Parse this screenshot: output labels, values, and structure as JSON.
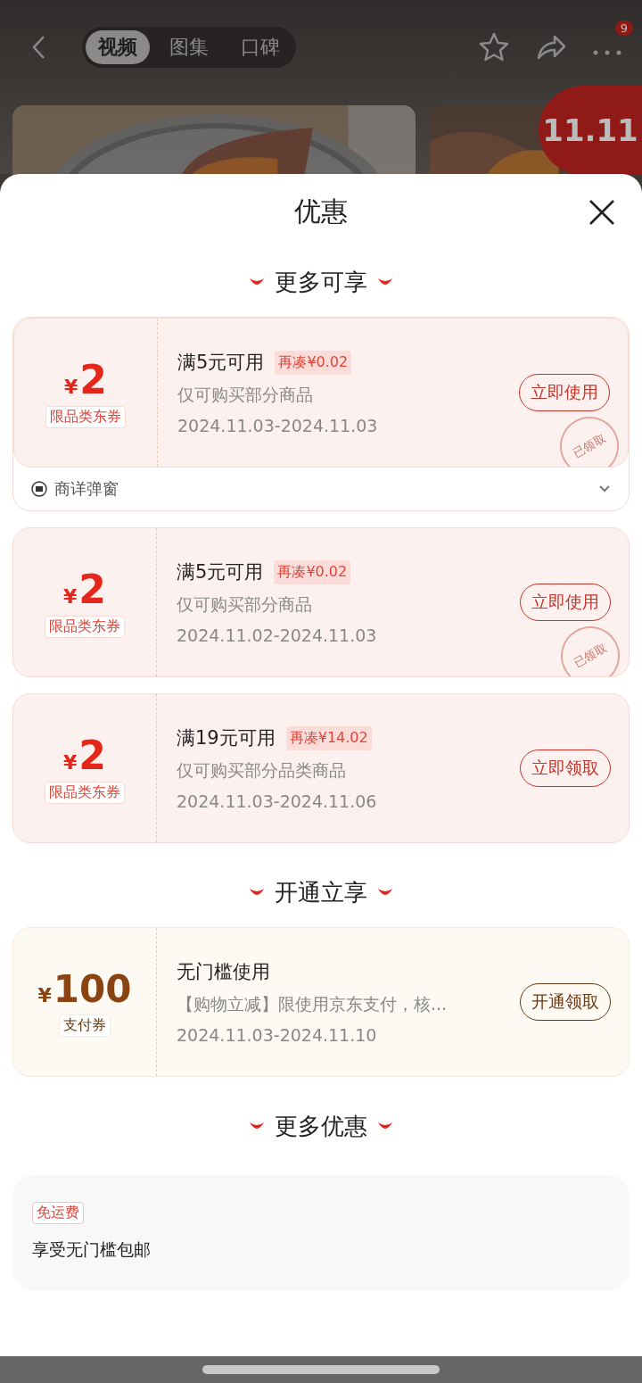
{
  "top_bar": {
    "tabs": [
      {
        "label": "视频",
        "selected": true
      },
      {
        "label": "图集",
        "selected": false
      },
      {
        "label": "口碑",
        "selected": false
      }
    ],
    "more_badge": "9",
    "promo_badge": "11.11"
  },
  "sheet": {
    "title": "优惠",
    "sections": [
      {
        "title": "更多可享",
        "coupons": [
          {
            "kind": "red",
            "amount": "2",
            "currency": "¥",
            "type": "限品类东券",
            "condition": "满5元可用",
            "gap": "再凑¥0.02",
            "desc": "仅可购买部分商品",
            "dates": "2024.11.03-2024.11.03",
            "action": "立即使用",
            "stamp": "已领取",
            "footer": "商详弹窗"
          },
          {
            "kind": "red",
            "amount": "2",
            "currency": "¥",
            "type": "限品类东券",
            "condition": "满5元可用",
            "gap": "再凑¥0.02",
            "desc": "仅可购买部分商品",
            "dates": "2024.11.02-2024.11.03",
            "action": "立即使用",
            "stamp": "已领取"
          },
          {
            "kind": "red",
            "amount": "2",
            "currency": "¥",
            "type": "限品类东券",
            "condition": "满19元可用",
            "gap": "再凑¥14.02",
            "desc": "仅可购买部分品类商品",
            "dates": "2024.11.03-2024.11.06",
            "action": "立即领取"
          }
        ]
      },
      {
        "title": "开通立享",
        "coupons": [
          {
            "kind": "gold",
            "amount": "100",
            "currency": "¥",
            "type": "支付券",
            "condition": "无门槛使用",
            "desc": "【购物立减】限使用京东支付，核...",
            "dates": "2024.11.03-2024.11.10",
            "action": "开通领取"
          }
        ]
      },
      {
        "title": "更多优惠",
        "offers": [
          {
            "tag": "免运费",
            "text": "享受无门槛包邮"
          }
        ]
      }
    ]
  }
}
